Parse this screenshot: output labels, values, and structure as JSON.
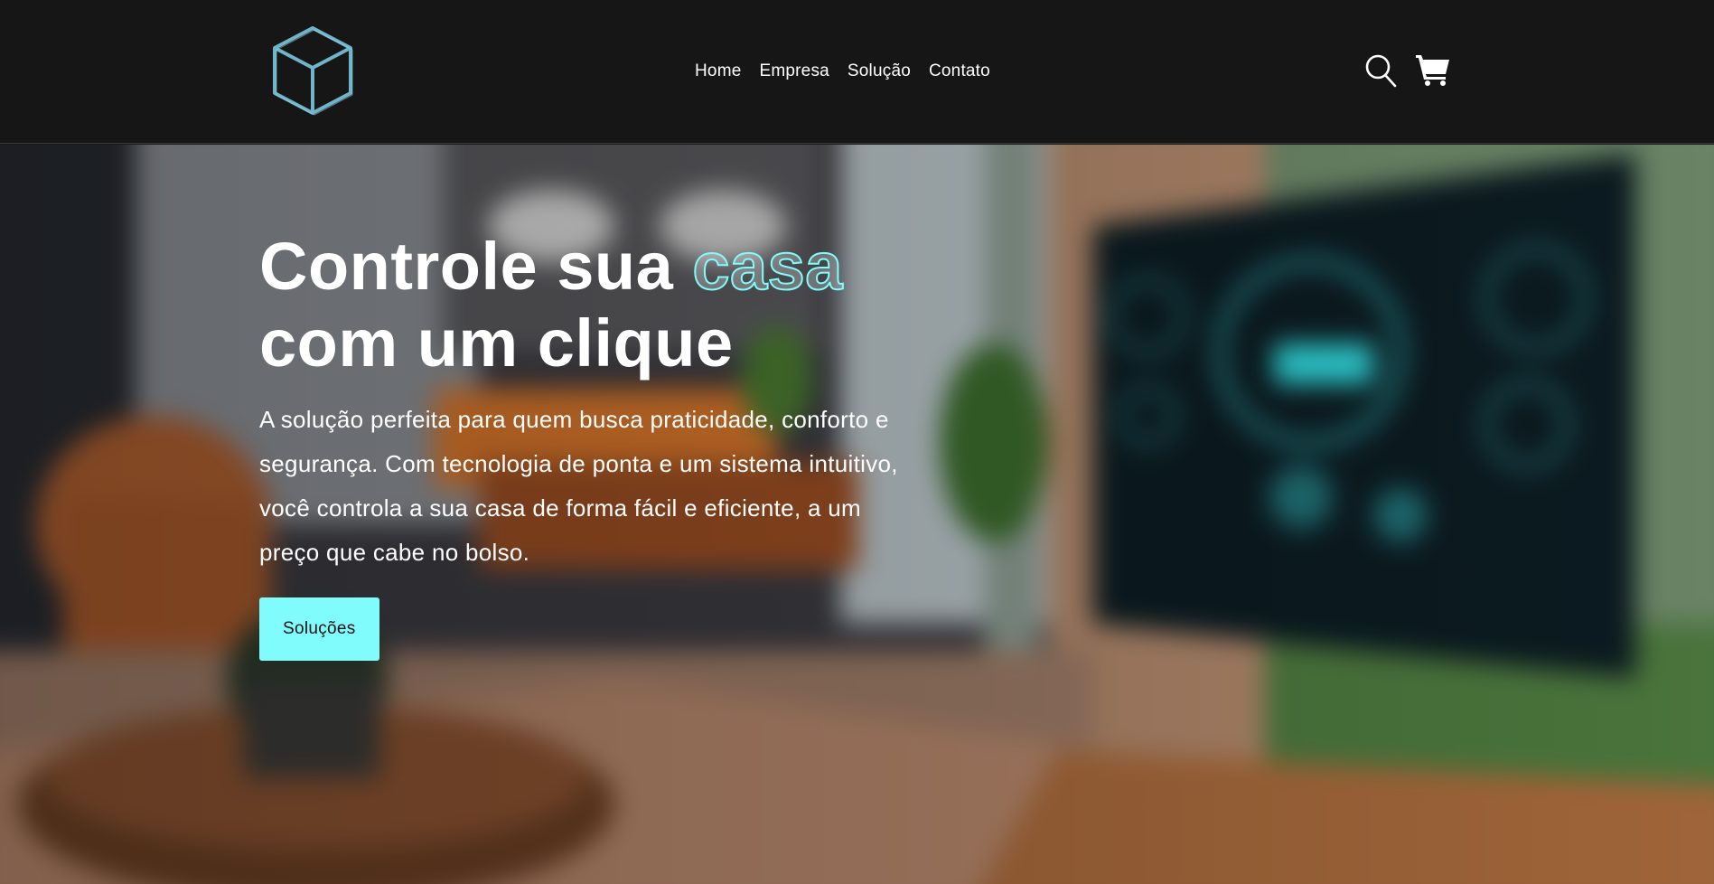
{
  "header": {
    "logo_icon": "cube-logo-icon",
    "nav": [
      {
        "label": "Home"
      },
      {
        "label": "Empresa"
      },
      {
        "label": "Solução"
      },
      {
        "label": "Contato"
      }
    ],
    "actions": {
      "search_icon": "search-icon",
      "cart_icon": "cart-icon"
    }
  },
  "hero": {
    "title_part1": "Controle sua ",
    "title_accent": "casa",
    "title_part2": "com um clique",
    "description": "A solução perfeita para quem busca praticidade, conforto e segurança. Com tecnologia de ponta e um sistema intuitivo, você controla a sua casa de forma fácil e eficiente, a um preço que cabe no bolso.",
    "cta_label": "Soluções"
  },
  "colors": {
    "header_bg": "#161616",
    "accent": "#7ffcfb",
    "text": "#ffffff",
    "logo_stroke": "#6fb4c8"
  }
}
